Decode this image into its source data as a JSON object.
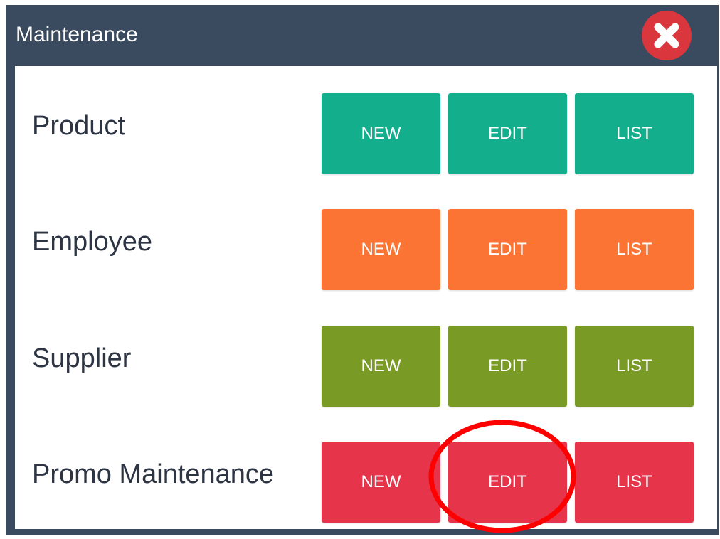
{
  "window": {
    "title": "Maintenance"
  },
  "rows": [
    {
      "label": "Product",
      "color": "#13ae8c",
      "buttons": {
        "new": "NEW",
        "edit": "EDIT",
        "list": "LIST"
      }
    },
    {
      "label": "Employee",
      "color": "#fb7433",
      "buttons": {
        "new": "NEW",
        "edit": "EDIT",
        "list": "LIST"
      }
    },
    {
      "label": "Supplier",
      "color": "#7a9a26",
      "buttons": {
        "new": "NEW",
        "edit": "EDIT",
        "list": "LIST"
      }
    },
    {
      "label": "Promo Maintenance",
      "color": "#e6354b",
      "buttons": {
        "new": "NEW",
        "edit": "EDIT",
        "list": "LIST"
      }
    }
  ],
  "icons": {
    "close": "close-icon"
  },
  "colors": {
    "titlebar": "#3a4a5f",
    "close_button": "#d9363e",
    "highlight_ring": "#ff0000"
  }
}
